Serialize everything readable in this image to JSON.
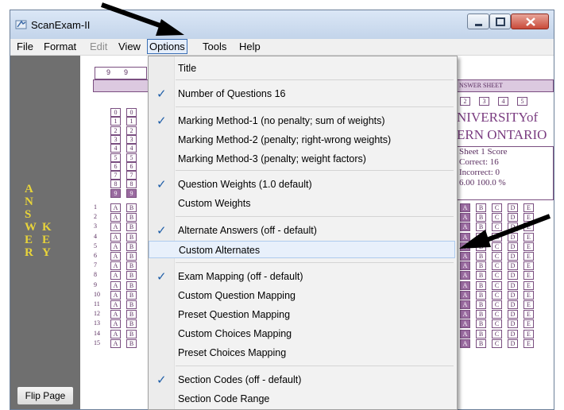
{
  "window": {
    "title": "ScanExam-II",
    "controls": [
      "minimize-icon",
      "maximize-icon",
      "close-icon"
    ]
  },
  "menubar": {
    "items": [
      {
        "label": "File",
        "enabled": true
      },
      {
        "label": "Format",
        "enabled": true
      },
      {
        "label": "Edit",
        "enabled": false
      },
      {
        "label": "View",
        "enabled": true
      },
      {
        "label": "Options",
        "enabled": true,
        "active": true
      },
      {
        "label": "Tools",
        "enabled": true
      },
      {
        "label": "Help",
        "enabled": true
      }
    ]
  },
  "left_panel": {
    "answer_letters": [
      "A",
      "N",
      "S",
      "W",
      "E",
      "R"
    ],
    "key_letters": [
      "K",
      "E",
      "Y"
    ],
    "flip_button": "Flip Page"
  },
  "sheet": {
    "header_digits": [
      "9",
      "9"
    ],
    "answer_sheet_label": "NSWER SHEET",
    "choice_numbers": [
      "2",
      "3",
      "4",
      "5"
    ],
    "university_line1": "NIVERSITYof",
    "university_line2": "ERN ONTARIO",
    "score": {
      "title": "Sheet 1 Score",
      "correct": "Correct:  16",
      "incorrect": "Incorrect:  0",
      "value": "6.00   100.0 %"
    },
    "id_digits": [
      "0",
      "1",
      "2",
      "3",
      "4",
      "5",
      "6",
      "7",
      "8",
      "9"
    ],
    "question_numbers": [
      "1",
      "2",
      "3",
      "4",
      "5",
      "6",
      "7",
      "8",
      "9",
      "10",
      "11",
      "12",
      "13",
      "14",
      "15"
    ],
    "choices": [
      "A",
      "B",
      "C",
      "D",
      "E"
    ]
  },
  "options_menu": {
    "items": [
      {
        "label": "Title",
        "checked": false
      },
      {
        "label": "Number of Questions 16",
        "checked": true
      },
      {
        "label": "Marking Method-1 (no penalty; sum of weights)",
        "checked": true
      },
      {
        "label": "Marking Method-2 (penalty; right-wrong weights)",
        "checked": false
      },
      {
        "label": "Marking Method-3 (penalty; weight factors)",
        "checked": false
      },
      {
        "label": "Question Weights (1.0 default)",
        "checked": true
      },
      {
        "label": "Custom Weights",
        "checked": false
      },
      {
        "label": "Alternate Answers (off - default)",
        "checked": true
      },
      {
        "label": "Custom Alternates",
        "checked": false,
        "highlighted": true
      },
      {
        "label": "Exam Mapping (off - default)",
        "checked": true
      },
      {
        "label": "Custom Question Mapping",
        "checked": false
      },
      {
        "label": "Preset Question Mapping",
        "checked": false
      },
      {
        "label": "Custom Choices Mapping",
        "checked": false
      },
      {
        "label": "Preset Choices Mapping",
        "checked": false
      },
      {
        "label": "Section Codes (off - default)",
        "checked": true
      },
      {
        "label": "Section Code Range",
        "checked": false
      }
    ],
    "check_glyph": "✓"
  },
  "annotations": {
    "arrow_color": "#000000",
    "targets": [
      "Options",
      "Custom Alternates"
    ]
  },
  "colors": {
    "sheet_accent": "#7a4e80",
    "key_text": "#e8d43a",
    "menu_check": "#1f5ea8"
  }
}
